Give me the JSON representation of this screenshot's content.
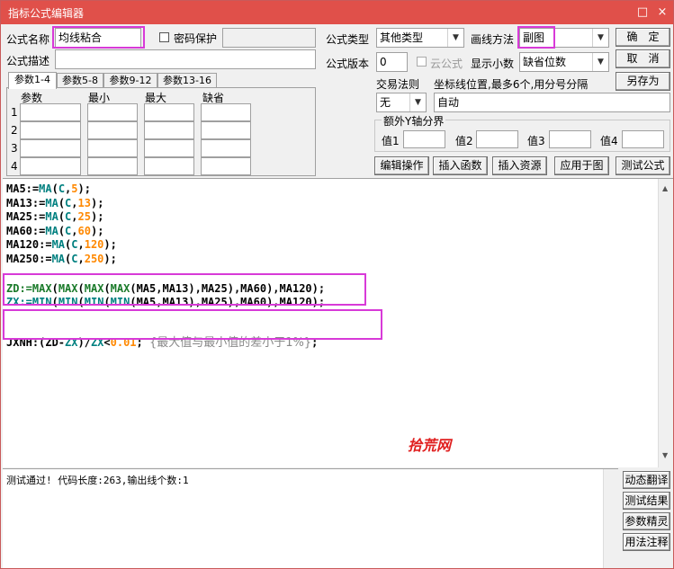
{
  "window": {
    "title": "指标公式编辑器",
    "restore_icon": "□",
    "close_icon": "×"
  },
  "form": {
    "name_label": "公式名称",
    "name_value": "均线粘合",
    "password_label": "密码保护",
    "desc_label": "公式描述",
    "desc_value": "",
    "type_label": "公式类型",
    "type_value": "其他类型",
    "draw_label": "画线方法",
    "draw_value": "副图",
    "version_label": "公式版本",
    "version_value": "0",
    "cloud_label": "云公式",
    "decimals_label": "显示小数",
    "decimals_value": "缺省位数",
    "trade_label": "交易法则",
    "trade_value": "无",
    "coord_label": "坐标线位置,最多6个,用分号分隔",
    "coord_value": "自动",
    "yaxis_group": "额外Y轴分界",
    "yaxis_labels": [
      "值1",
      "值2",
      "值3",
      "值4"
    ]
  },
  "buttons": {
    "ok": "确　定",
    "cancel": "取　消",
    "save_as": "另存为",
    "edit_ops": "编辑操作",
    "insert_func": "插入函数",
    "insert_res": "插入资源",
    "apply_chart": "应用于图",
    "test_formula": "测试公式"
  },
  "param_tabs": [
    "参数1-4",
    "参数5-8",
    "参数9-12",
    "参数13-16"
  ],
  "param_headers": [
    "参数",
    "最小",
    "最大",
    "缺省"
  ],
  "param_rows": [
    "1",
    "2",
    "3",
    "4"
  ],
  "code_lines": [
    [
      {
        "t": "MA5:=",
        "c": ""
      },
      {
        "t": "MA",
        "c": "fn"
      },
      {
        "t": "(",
        "c": ""
      },
      {
        "t": "C",
        "c": "fn"
      },
      {
        "t": ",",
        "c": ""
      },
      {
        "t": "5",
        "c": "num"
      },
      {
        "t": ");",
        "c": ""
      }
    ],
    [
      {
        "t": "MA13:=",
        "c": ""
      },
      {
        "t": "MA",
        "c": "fn"
      },
      {
        "t": "(",
        "c": ""
      },
      {
        "t": "C",
        "c": "fn"
      },
      {
        "t": ",",
        "c": ""
      },
      {
        "t": "13",
        "c": "num"
      },
      {
        "t": ");",
        "c": ""
      }
    ],
    [
      {
        "t": "MA25:=",
        "c": ""
      },
      {
        "t": "MA",
        "c": "fn"
      },
      {
        "t": "(",
        "c": ""
      },
      {
        "t": "C",
        "c": "fn"
      },
      {
        "t": ",",
        "c": ""
      },
      {
        "t": "25",
        "c": "num"
      },
      {
        "t": ");",
        "c": ""
      }
    ],
    [
      {
        "t": "MA60:=",
        "c": ""
      },
      {
        "t": "MA",
        "c": "fn"
      },
      {
        "t": "(",
        "c": ""
      },
      {
        "t": "C",
        "c": "fn"
      },
      {
        "t": ",",
        "c": ""
      },
      {
        "t": "60",
        "c": "num"
      },
      {
        "t": ");",
        "c": ""
      }
    ],
    [
      {
        "t": "MA120:=",
        "c": ""
      },
      {
        "t": "MA",
        "c": "fn"
      },
      {
        "t": "(",
        "c": ""
      },
      {
        "t": "C",
        "c": "fn"
      },
      {
        "t": ",",
        "c": ""
      },
      {
        "t": "120",
        "c": "num"
      },
      {
        "t": ");",
        "c": ""
      }
    ],
    [
      {
        "t": "MA250:=",
        "c": ""
      },
      {
        "t": "MA",
        "c": "fn"
      },
      {
        "t": "(",
        "c": ""
      },
      {
        "t": "C",
        "c": "fn"
      },
      {
        "t": ",",
        "c": ""
      },
      {
        "t": "250",
        "c": "num"
      },
      {
        "t": ");",
        "c": ""
      }
    ],
    [],
    [
      {
        "t": "ZD:=",
        "c": "kw"
      },
      {
        "t": "MAX",
        "c": "kw"
      },
      {
        "t": "(",
        "c": ""
      },
      {
        "t": "MAX",
        "c": "kw"
      },
      {
        "t": "(",
        "c": ""
      },
      {
        "t": "MAX",
        "c": "kw"
      },
      {
        "t": "(",
        "c": ""
      },
      {
        "t": "MAX",
        "c": "kw"
      },
      {
        "t": "(MA5,MA13),MA25),MA60),MA120);",
        "c": ""
      }
    ],
    [
      {
        "t": "ZX:=",
        "c": "fn"
      },
      {
        "t": "MIN",
        "c": "fn"
      },
      {
        "t": "(",
        "c": ""
      },
      {
        "t": "MIN",
        "c": "fn"
      },
      {
        "t": "(",
        "c": ""
      },
      {
        "t": "MIN",
        "c": "fn"
      },
      {
        "t": "(",
        "c": ""
      },
      {
        "t": "MIN",
        "c": "fn"
      },
      {
        "t": "(MA5,MA13),MA25),MA60),MA120);",
        "c": ""
      }
    ],
    [],
    [
      {
        "t": "JXNH:(ZD-",
        "c": ""
      },
      {
        "t": "ZX",
        "c": "fn"
      },
      {
        "t": ")/",
        "c": ""
      },
      {
        "t": "ZX",
        "c": "fn"
      },
      {
        "t": "<",
        "c": ""
      },
      {
        "t": "0.01",
        "c": "num"
      },
      {
        "t": "; ",
        "c": ""
      },
      {
        "t": "{最大值与最小值的差小于1%}",
        "c": "cm"
      },
      {
        "t": ";",
        "c": ""
      }
    ]
  ],
  "watermark": "拾荒网",
  "output_text": "测试通过! 代码长度:263,输出线个数:1",
  "side_buttons": [
    "动态翻译",
    "测试结果",
    "参数精灵",
    "用法注释"
  ],
  "colors": {
    "titlebar": "#e0504a",
    "highlight": "#d83ad8",
    "watermark": "#e02020"
  }
}
